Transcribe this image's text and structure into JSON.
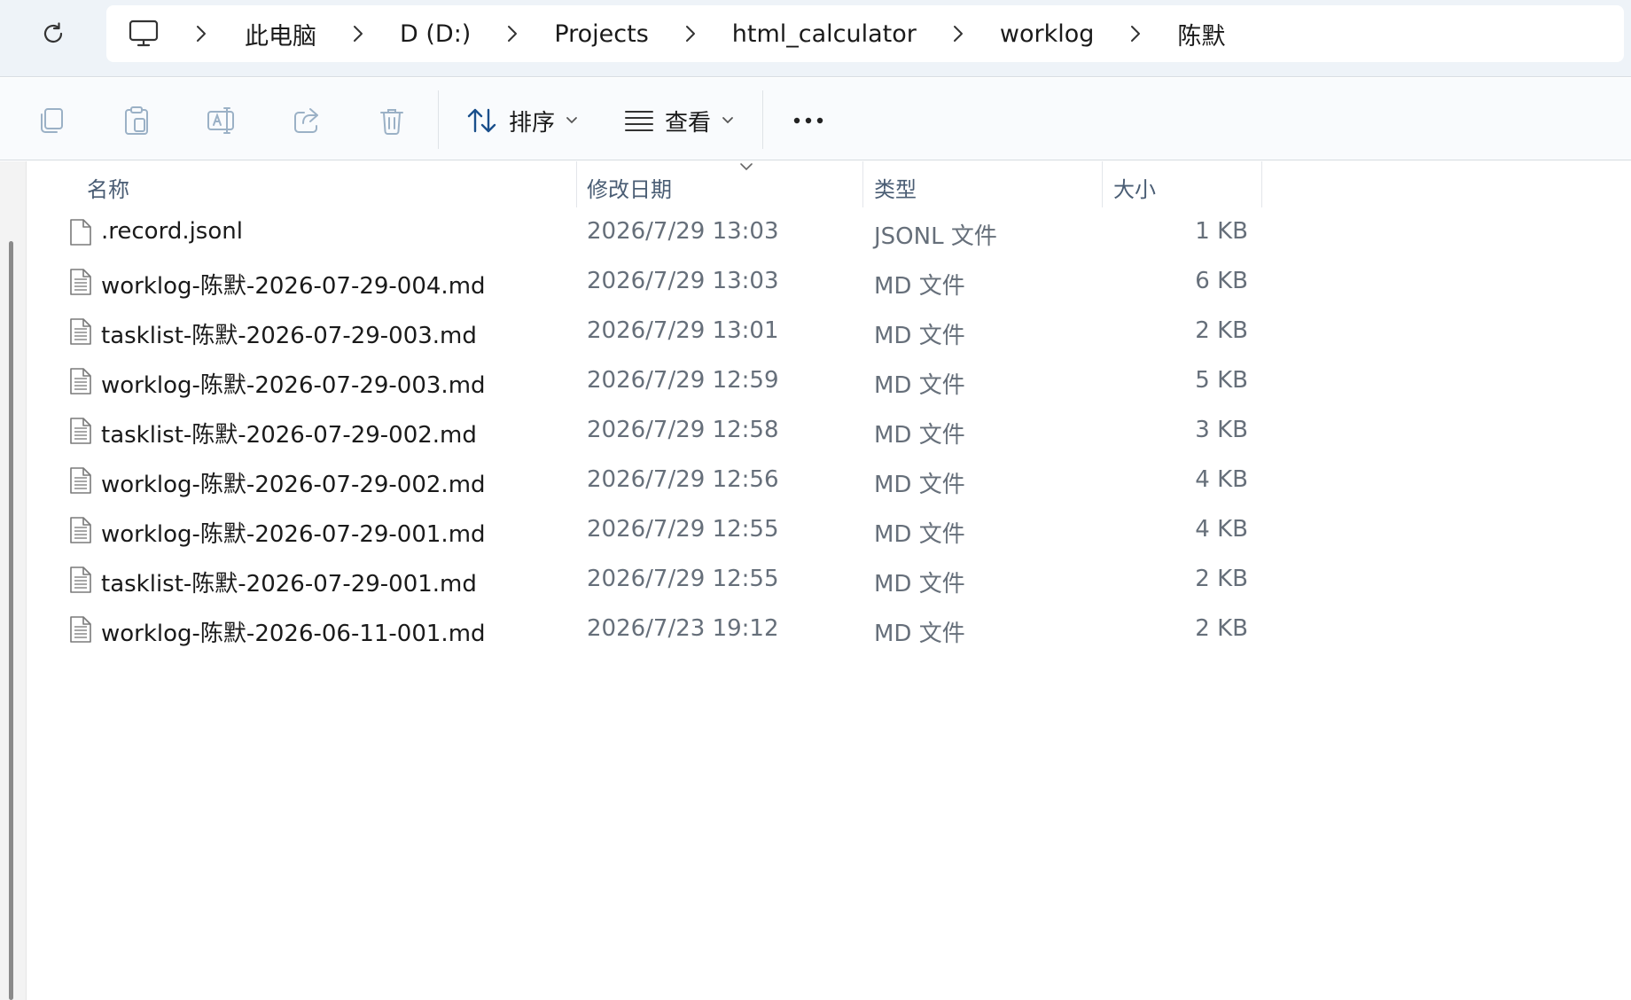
{
  "breadcrumb": {
    "items": [
      "此电脑",
      "D (D:)",
      "Projects",
      "html_calculator",
      "worklog",
      "陈默"
    ]
  },
  "toolbar": {
    "sort_label": "排序",
    "view_label": "查看"
  },
  "columns": {
    "name": "名称",
    "date": "修改日期",
    "type": "类型",
    "size": "大小"
  },
  "files": [
    {
      "name": ".record.jsonl",
      "date": "2026/7/29 13:03",
      "type": "JSONL 文件",
      "size": "1 KB",
      "icon": "blank-file-icon"
    },
    {
      "name": "worklog-陈默-2026-07-29-004.md",
      "date": "2026/7/29 13:03",
      "type": "MD 文件",
      "size": "6 KB",
      "icon": "text-file-icon"
    },
    {
      "name": "tasklist-陈默-2026-07-29-003.md",
      "date": "2026/7/29 13:01",
      "type": "MD 文件",
      "size": "2 KB",
      "icon": "text-file-icon"
    },
    {
      "name": "worklog-陈默-2026-07-29-003.md",
      "date": "2026/7/29 12:59",
      "type": "MD 文件",
      "size": "5 KB",
      "icon": "text-file-icon"
    },
    {
      "name": "tasklist-陈默-2026-07-29-002.md",
      "date": "2026/7/29 12:58",
      "type": "MD 文件",
      "size": "3 KB",
      "icon": "text-file-icon"
    },
    {
      "name": "worklog-陈默-2026-07-29-002.md",
      "date": "2026/7/29 12:56",
      "type": "MD 文件",
      "size": "4 KB",
      "icon": "text-file-icon"
    },
    {
      "name": "worklog-陈默-2026-07-29-001.md",
      "date": "2026/7/29 12:55",
      "type": "MD 文件",
      "size": "4 KB",
      "icon": "text-file-icon"
    },
    {
      "name": "tasklist-陈默-2026-07-29-001.md",
      "date": "2026/7/29 12:55",
      "type": "MD 文件",
      "size": "2 KB",
      "icon": "text-file-icon"
    },
    {
      "name": "worklog-陈默-2026-06-11-001.md",
      "date": "2026/7/23 19:12",
      "type": "MD 文件",
      "size": "2 KB",
      "icon": "text-file-icon"
    }
  ],
  "colors": {
    "accent": "#4a5d74",
    "muted_text": "#666f7a",
    "topbar_bg": "#eef3f8"
  }
}
